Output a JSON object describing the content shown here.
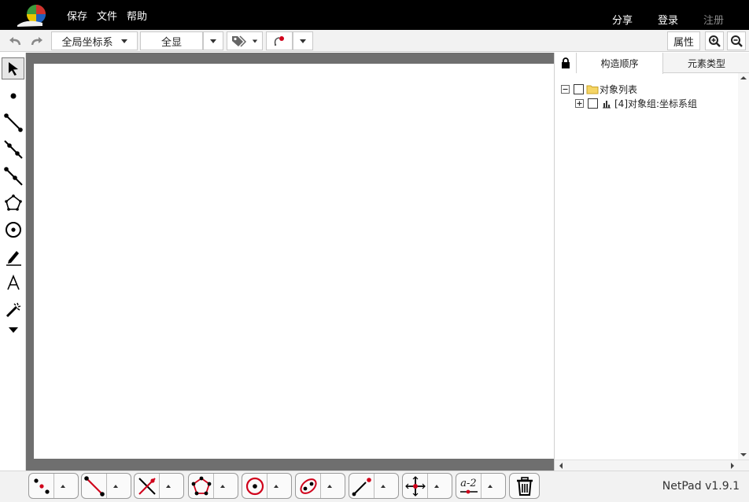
{
  "menu": {
    "save": "保存",
    "file": "文件",
    "help": "帮助"
  },
  "account": {
    "share": "分享",
    "login": "登录",
    "register": "注册"
  },
  "toolbar": {
    "coordinate_system": "全局坐标系",
    "view": "全显",
    "properties": "属性"
  },
  "icons": {
    "undo": "undo-icon",
    "redo": "redo-icon",
    "tag": "tag-icon",
    "point-style": "point-style-icon",
    "zoom_in": "zoom-in-icon",
    "zoom_out": "zoom-out-icon",
    "lock": "lock-icon"
  },
  "left_tools": [
    "select-arrow-icon",
    "point-icon",
    "segment-icon",
    "line-icon",
    "ray-icon",
    "polygon-icon",
    "circle-icon",
    "pen-icon",
    "text-icon",
    "magic-wand-icon",
    "more-tools-icon"
  ],
  "right_panel": {
    "tabs": [
      "构造顺序",
      "元素类型"
    ],
    "tree": {
      "root_label": "对象列表",
      "children": [
        {
          "label": "[4]对象组:坐标系组"
        }
      ]
    }
  },
  "bottom_tools": [
    "point-tool",
    "segment-tool",
    "intersection-tool",
    "polygon-tool",
    "circle-tool",
    "conic-tool",
    "ray-point-tool",
    "transform-tool",
    "measure-tool",
    "delete-tool"
  ],
  "measure_label": "a-2",
  "version": "NetPad v1.9.1",
  "colors": {
    "accent_red": "#d0021b",
    "topbar_bg": "#000000",
    "canvas_frame": "#6f6f6f"
  }
}
